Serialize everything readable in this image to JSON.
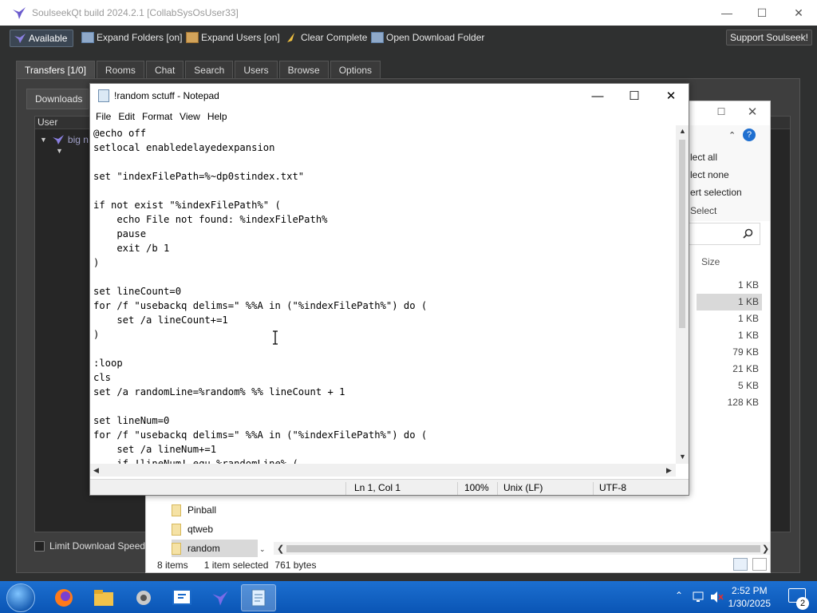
{
  "soulseek": {
    "title": "SoulseekQt build 2024.2.1 [CollabSysOsUser33]",
    "toolbar": {
      "available": "Available",
      "expand_folders": "Expand Folders [on]",
      "expand_users": "Expand Users [on]",
      "clear_complete": "Clear Complete",
      "open_download_folder": "Open Download Folder",
      "support": "Support Soulseek!"
    },
    "tabs": [
      "Transfers [1/0]",
      "Rooms",
      "Chat",
      "Search",
      "Users",
      "Browse",
      "Options"
    ],
    "subtab": "Downloads",
    "column_user": "User",
    "download_user": "big n",
    "limit_label": "Limit Download Speed to"
  },
  "explorer": {
    "ribbon": [
      "lect all",
      "lect none",
      "ert selection",
      "Select"
    ],
    "column_size": "Size",
    "sizes": [
      "1 KB",
      "1 KB",
      "1 KB",
      "1 KB",
      "79 KB",
      "21 KB",
      "5 KB",
      "128 KB"
    ],
    "nav_items": [
      "Pinball",
      "qtweb",
      "random"
    ],
    "status": {
      "items": "8 items",
      "selected": "1 item selected",
      "bytes": "761 bytes"
    }
  },
  "notepad": {
    "title": "!random sctuff - Notepad",
    "menu": [
      "File",
      "Edit",
      "Format",
      "View",
      "Help"
    ],
    "lines": [
      "@echo off",
      "setlocal enabledelayedexpansion",
      "",
      "set \"indexFilePath=%~dp0stindex.txt\"",
      "",
      "if not exist \"%indexFilePath%\" (",
      "    echo File not found: %indexFilePath%",
      "    pause",
      "    exit /b 1",
      ")",
      "",
      "set lineCount=0",
      "for /f \"usebackq delims=\" %%A in (\"%indexFilePath%\") do (",
      "    set /a lineCount+=1",
      ")",
      "",
      ":loop",
      "cls",
      "set /a randomLine=%random% %% lineCount + 1",
      "",
      "set lineNum=0",
      "for /f \"usebackq delims=\" %%A in (\"%indexFilePath%\") do (",
      "    set /a lineNum+=1",
      "    if !lineNum! equ %randomLine% ("
    ],
    "status": {
      "position": "Ln 1, Col 1",
      "zoom": "100%",
      "line_ending": "Unix (LF)",
      "encoding": "UTF-8"
    }
  },
  "taskbar": {
    "time": "2:52 PM",
    "date": "1/30/2025",
    "notifications": "2"
  }
}
